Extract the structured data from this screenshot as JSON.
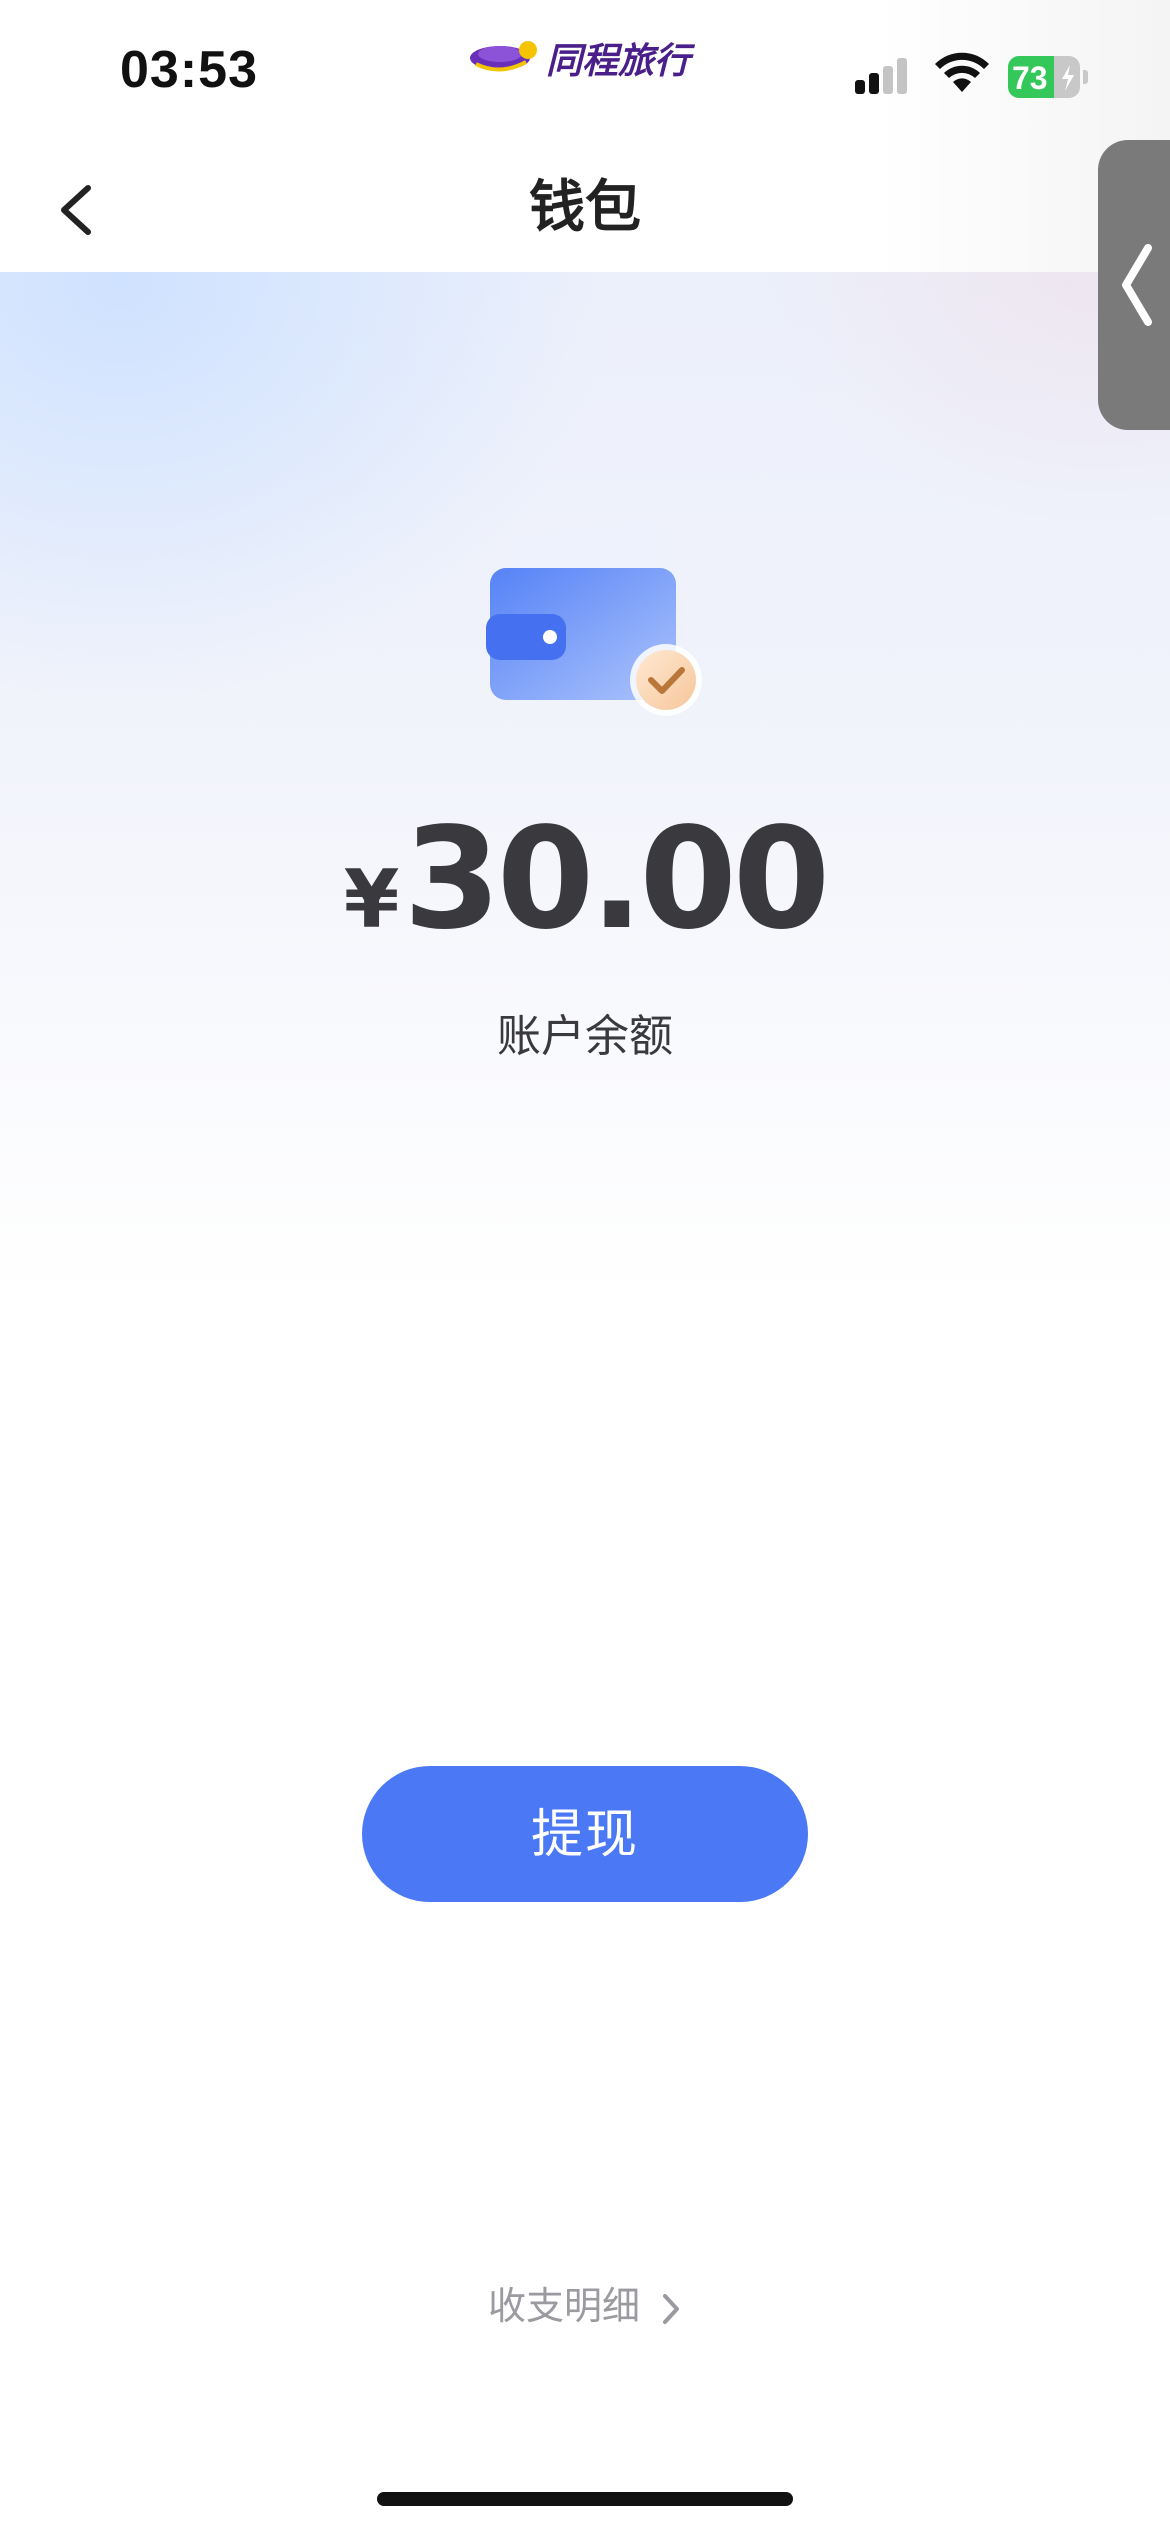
{
  "status_bar": {
    "time": "03:53",
    "battery_level": "73",
    "signal_icon": "cellular-signal-icon",
    "wifi_icon": "wifi-icon",
    "battery_icon": "battery-charging-icon"
  },
  "brand": {
    "name": "同程旅行",
    "logo_icon": "tongcheng-logo-icon",
    "color": "#4a1f8a"
  },
  "nav": {
    "title": "钱包",
    "back_icon": "chevron-left-icon",
    "side_handle_icon": "chevron-left-icon"
  },
  "wallet": {
    "icon": "wallet-check-icon",
    "currency_symbol": "¥",
    "balance": "30.00",
    "balance_label": "账户余额"
  },
  "actions": {
    "withdraw_label": "提现",
    "details_label": "收支明细",
    "details_icon": "chevron-right-icon"
  },
  "colors": {
    "accent": "#4b79f5",
    "battery_green": "#34c759",
    "text_primary": "#3a3a3e",
    "text_secondary": "#9a9aa0"
  }
}
